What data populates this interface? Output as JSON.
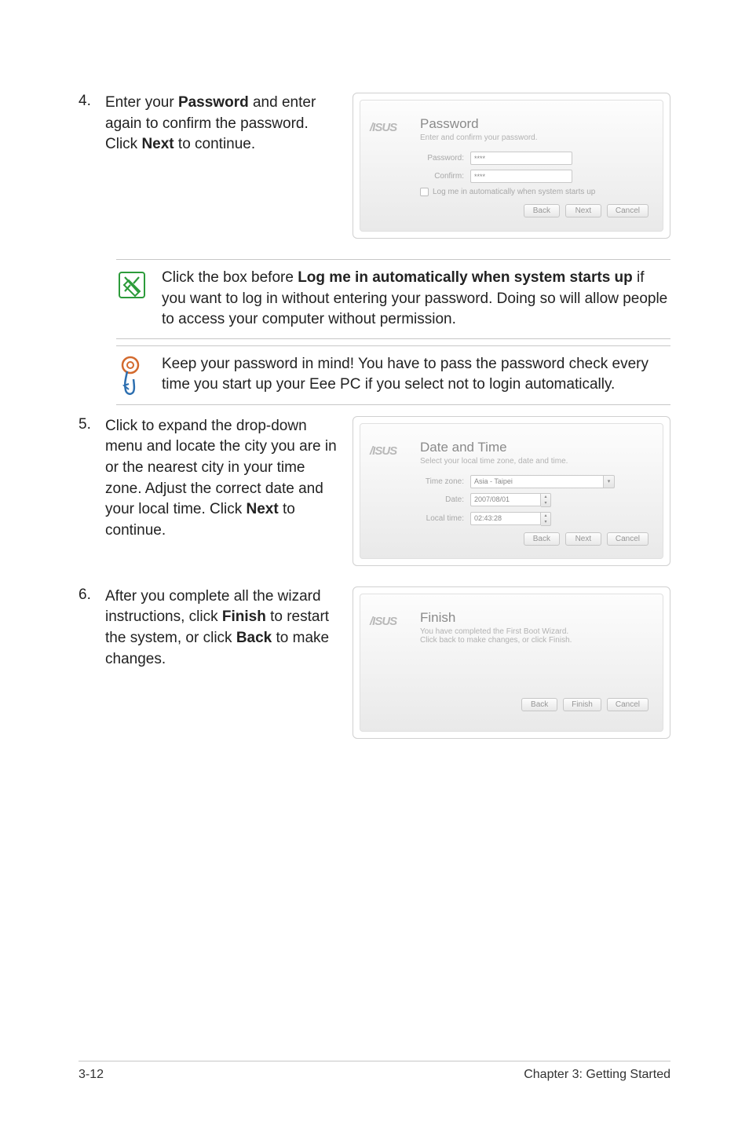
{
  "steps": {
    "s4": {
      "num": "4.",
      "text_a": "Enter your ",
      "text_b": "Password",
      "text_c": " and enter again to confirm the password. Click ",
      "text_d": "Next",
      "text_e": " to continue."
    },
    "s5": {
      "num": "5.",
      "text_a": "Click to expand the drop-down menu and locate the city you are in or the nearest city in your time zone. Adjust the correct date and your local time. Click ",
      "text_b": "Next",
      "text_c": " to continue."
    },
    "s6": {
      "num": "6.",
      "text_a": "After you complete all the wizard instructions, click ",
      "text_b": "Finish",
      "text_c": " to restart the system, or click ",
      "text_d": "Back",
      "text_e": " to make changes."
    }
  },
  "callouts": {
    "c1": {
      "a": "Click the box before ",
      "b": "Log me in automatically when system starts up",
      "c": " if you want to log in without entering your password. Doing so will allow people to access your computer without permission."
    },
    "c2": {
      "text": "Keep your password in mind! You have to pass the password check every time you start up your Eee PC if you select not to login automatically."
    }
  },
  "wizards": {
    "logo": "ISUS",
    "password": {
      "title": "Password",
      "sub": "Enter and confirm your password.",
      "label_pw": "Password:",
      "label_cf": "Confirm:",
      "val_pw": "****",
      "val_cf": "****",
      "chk": "Log me in automatically when system starts up"
    },
    "datetime": {
      "title": "Date and Time",
      "sub": "Select your local time zone, date and time.",
      "label_tz": "Time zone:",
      "label_date": "Date:",
      "label_time": "Local time:",
      "val_tz": "Asia - Taipei",
      "val_date": "2007/08/01",
      "val_time": "02:43:28"
    },
    "finish": {
      "title": "Finish",
      "sub1": "You have completed the First Boot Wizard.",
      "sub2": "Click back to make changes, or click Finish."
    },
    "buttons": {
      "back": "Back",
      "next": "Next",
      "cancel": "Cancel",
      "finish": "Finish"
    }
  },
  "footer": {
    "left": "3-12",
    "right": "Chapter 3: Getting Started"
  }
}
